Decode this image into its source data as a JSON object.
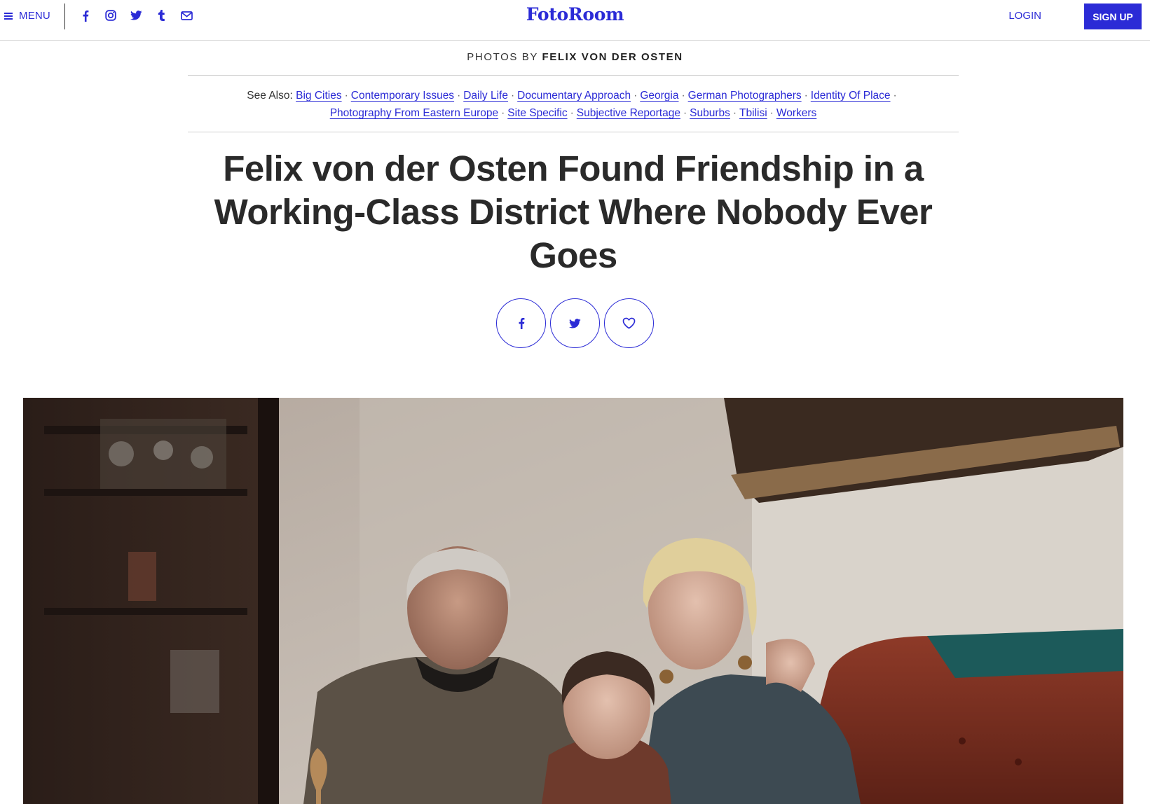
{
  "header": {
    "menu_label": "MENU",
    "logo": "FotoRoom",
    "login_label": "LOGIN",
    "signup_label": "SIGN UP",
    "social_icons": [
      "facebook-icon",
      "instagram-icon",
      "twitter-icon",
      "tumblr-icon",
      "email-icon"
    ]
  },
  "byline": {
    "prefix": "PHOTOS BY",
    "author": "FELIX VON DER OSTEN"
  },
  "see_also": {
    "label": "See Also:",
    "tags": [
      "Big Cities",
      "Contemporary Issues",
      "Daily Life",
      "Documentary Approach",
      "Georgia",
      "German Photographers",
      "Identity Of Place",
      "Photography From Eastern Europe",
      "Site Specific",
      "Subjective Reportage",
      "Suburbs",
      "Tbilisi",
      "Workers"
    ]
  },
  "article": {
    "headline": "Felix von der Osten Found Friendship in a Working-Class District Where Nobody Ever Goes"
  },
  "share": [
    "facebook-share",
    "twitter-share",
    "favorite"
  ],
  "colors": {
    "accent": "#2b2bd6",
    "headline": "#2a2a2a",
    "rule": "#cfcfcf"
  }
}
